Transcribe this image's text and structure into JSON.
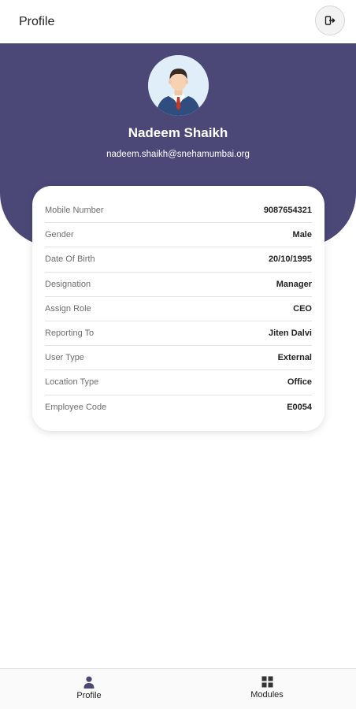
{
  "appbar": {
    "title": "Profile",
    "logout_icon": "logout-icon"
  },
  "profile": {
    "name": "Nadeem Shaikh",
    "email": "nadeem.shaikh@snehamumbai.org",
    "avatar_icon": "user-avatar-illustration"
  },
  "details": [
    {
      "label": "Mobile Number",
      "value": "9087654321"
    },
    {
      "label": "Gender",
      "value": "Male"
    },
    {
      "label": "Date Of Birth",
      "value": "20/10/1995"
    },
    {
      "label": "Designation",
      "value": "Manager"
    },
    {
      "label": "Assign Role",
      "value": "CEO"
    },
    {
      "label": "Reporting To",
      "value": "Jiten Dalvi"
    },
    {
      "label": "User Type",
      "value": "External"
    },
    {
      "label": "Location Type",
      "value": "Office"
    },
    {
      "label": "Employee Code",
      "value": "E0054"
    }
  ],
  "bottom_nav": [
    {
      "label": "Profile",
      "icon": "person-icon",
      "active": true
    },
    {
      "label": "Modules",
      "icon": "grid-icon",
      "active": false
    }
  ],
  "colors": {
    "header_bg": "#4b4878",
    "nav_active": "#4b4878",
    "card_bg": "#ffffff"
  }
}
